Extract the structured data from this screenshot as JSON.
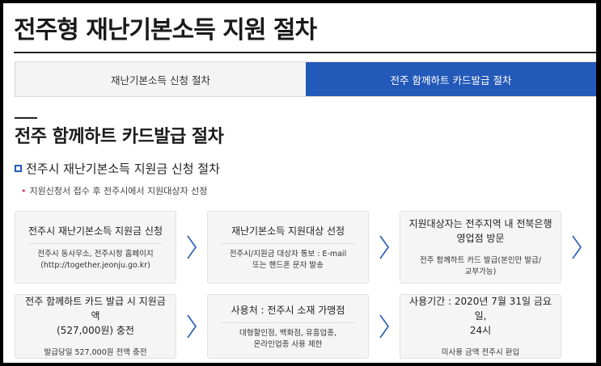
{
  "page_title": "전주형 재난기본소득 지원 절차",
  "tabs": [
    {
      "label": "재난기본소득 신청 절차",
      "active": false
    },
    {
      "label": "전주 함께하트 카드발급 절차",
      "active": true
    }
  ],
  "section_title": "전주 함께하트 카드발급 절차",
  "sub_title": "전주시 재난기본소득 지원금 신청 절차",
  "note": "지원신청서 접수 후 전주시에서 지원대상자 선정",
  "steps_row1": [
    {
      "head": "전주시 재난기본소득 지원금 신청",
      "body": "전주시 동사무소, 전주시청 홈페이지\n(http://together.jeonju.go.kr)"
    },
    {
      "head": "재난기본소득 지원대상 선정",
      "body": "전주시/지원금 대상자 통보 : E-mail\n또는 핸드폰 문자 발송"
    },
    {
      "head": "지원대상자는 전주지역 내 전북은행\n영업점 방문",
      "body": "전주 함께하트 카드 발급(본인만 발급/\n교부가능)"
    }
  ],
  "steps_row2": [
    {
      "head": "전주 함께하트 카드 발급 시 지원금액\n(527,000원) 충전",
      "body": "발급당일 527,000원 전액 충전"
    },
    {
      "head": "사용처 : 전주시 소재 가맹점",
      "body": "대형할인점, 백화점, 유흥업종,\n온라인업종 사용 제한"
    },
    {
      "head": "사용기간 : 2020년 7월 31일 금요일,\n24시",
      "body": "미사용 금액 전주시 환입"
    }
  ],
  "icons": {
    "arrow": "chevron-right-icon",
    "bullet": "square-bullet-icon"
  },
  "colors": {
    "accent": "#2359b8",
    "note_bullet": "#dd3333",
    "card_bg": "#f5f5f5"
  }
}
